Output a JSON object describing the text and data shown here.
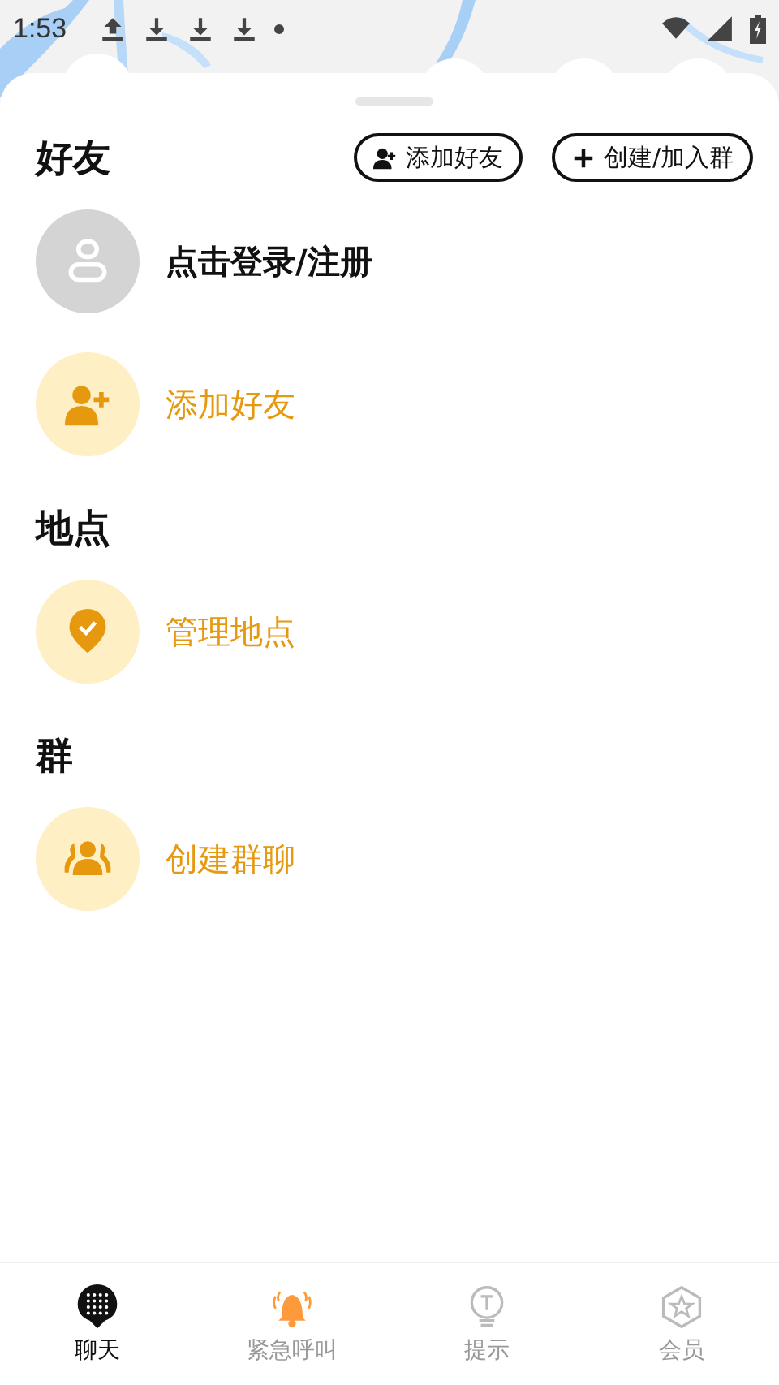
{
  "status_bar": {
    "time": "1:53"
  },
  "sections": [
    {
      "title": "好友",
      "actions": [
        {
          "label": "添加好友",
          "kind": "add-friend"
        },
        {
          "label": "创建/加入群",
          "kind": "plus"
        }
      ],
      "items": [
        {
          "label": "点击登录/注册",
          "kind": "account"
        },
        {
          "label": "添加好友",
          "kind": "add-friend"
        }
      ]
    },
    {
      "title": "地点",
      "items": [
        {
          "label": "管理地点",
          "kind": "place"
        }
      ]
    },
    {
      "title": "群",
      "items": [
        {
          "label": "创建群聊",
          "kind": "group"
        }
      ]
    }
  ],
  "tabs": [
    {
      "label": "聊天",
      "kind": "chat",
      "selected": true
    },
    {
      "label": "紧急呼叫",
      "kind": "alarm",
      "selected": false
    },
    {
      "label": "提示",
      "kind": "tip",
      "selected": false
    },
    {
      "label": "会员",
      "kind": "member",
      "selected": false
    }
  ]
}
